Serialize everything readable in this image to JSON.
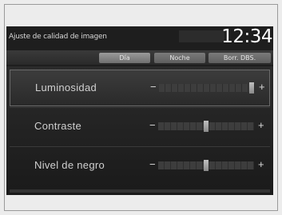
{
  "header": {
    "title": "Ajuste de calidad de imagen",
    "clock": "12:34"
  },
  "tabs": [
    {
      "label": "Día",
      "active": true
    },
    {
      "label": "Noche",
      "active": false
    },
    {
      "label": "Borr. DBS.",
      "active": false
    }
  ],
  "settings": [
    {
      "label": "Luminosidad",
      "level": 1.0,
      "selected": true
    },
    {
      "label": "Contraste",
      "level": 0.5,
      "selected": false
    },
    {
      "label": "Nivel de negro",
      "level": 0.5,
      "selected": false
    }
  ],
  "controls": {
    "minus": "−",
    "plus": "+"
  }
}
